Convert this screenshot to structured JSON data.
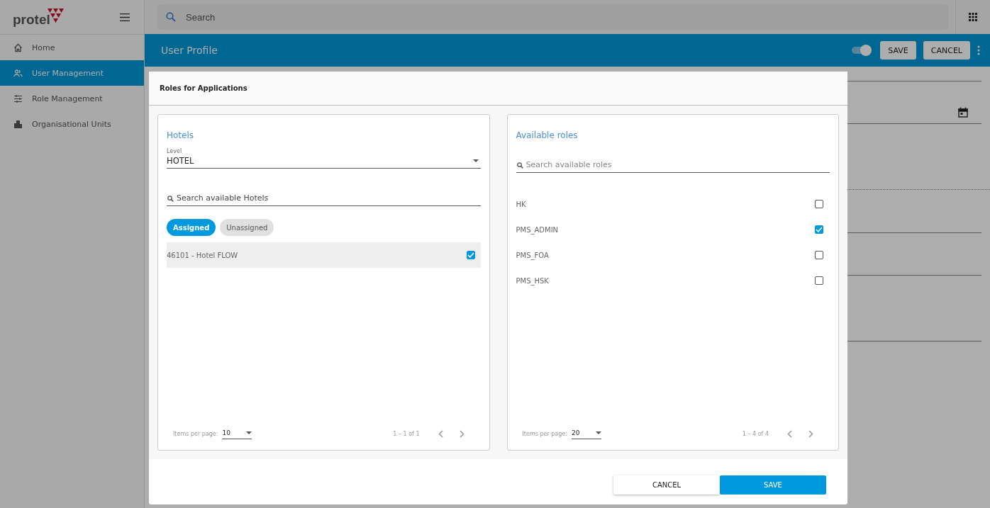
{
  "app": {
    "logo": "protel",
    "search_placeholder": "Search"
  },
  "sidebar": {
    "items": [
      {
        "label": "Home",
        "selected": false
      },
      {
        "label": "User Management",
        "selected": true
      },
      {
        "label": "Role Management",
        "selected": false
      },
      {
        "label": "Organisational Units",
        "selected": false
      }
    ]
  },
  "header": {
    "title": "User Profile",
    "toggle_on": true,
    "buttons": [
      "SAVE",
      "CANCEL"
    ]
  },
  "dialog": {
    "title": "Roles for Applications",
    "hotels": {
      "title": "Hotels",
      "level_label": "Level",
      "level_value": "HOTEL",
      "search_placeholder": "Search available Hotels",
      "filters": [
        {
          "label": "Assigned",
          "selected": true
        },
        {
          "label": "Unassigned",
          "selected": false
        }
      ],
      "items": [
        {
          "label": "46101 - Hotel FLOW",
          "checked": true
        }
      ],
      "items_per_page_label": "Items per page:",
      "items_per_page": "10",
      "range": "1 – 1 of 1"
    },
    "roles": {
      "title": "Available roles",
      "search_placeholder": "Search available roles",
      "items": [
        {
          "label": "HK",
          "checked": false
        },
        {
          "label": "PMS_ADMIN",
          "checked": true
        },
        {
          "label": "PMS_FOA",
          "checked": false
        },
        {
          "label": "PMS_HSK",
          "checked": false
        }
      ],
      "items_per_page_label": "Items per page:",
      "items_per_page": "20",
      "range": "1 – 4 of 4"
    },
    "buttons": [
      {
        "label": "CANCEL",
        "kind": "secondary"
      },
      {
        "label": "SAVE",
        "kind": "primary"
      }
    ]
  }
}
